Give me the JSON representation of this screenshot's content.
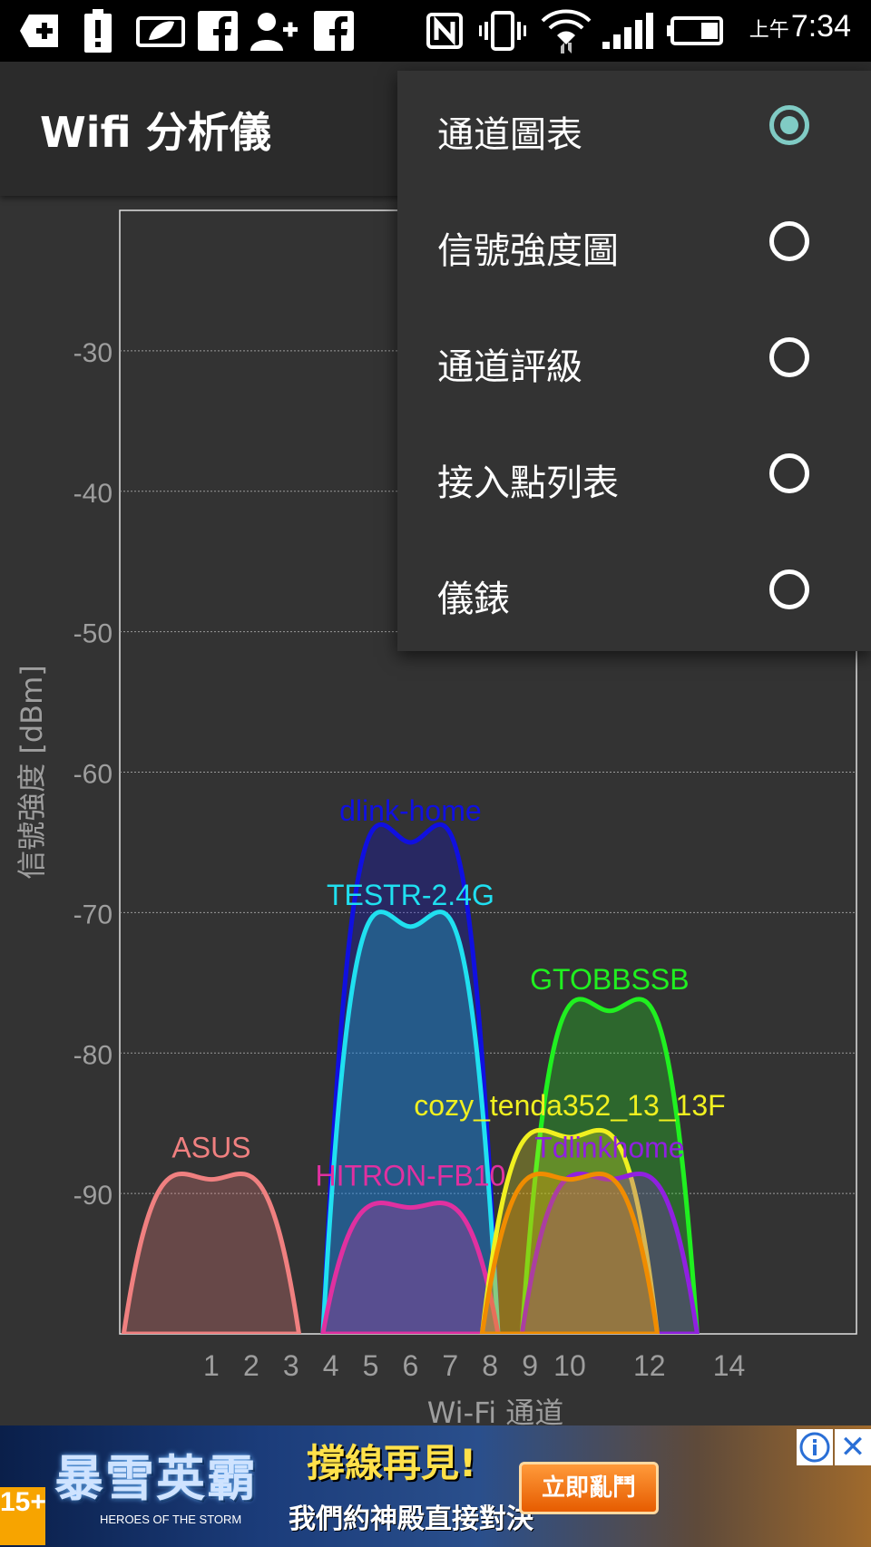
{
  "status_bar": {
    "time_prefix": "上午",
    "time": "7:34",
    "icons": [
      "add-box-icon",
      "battery-alert-icon",
      "leaf-icon",
      "facebook-icon",
      "add-user-icon",
      "facebook-icon",
      "nfc-icon",
      "vibrate-icon",
      "wifi-icon",
      "signal-icon",
      "battery-icon"
    ]
  },
  "app_bar": {
    "title": "Wifi 分析儀"
  },
  "menu": {
    "items": [
      {
        "label": "通道圖表",
        "checked": true
      },
      {
        "label": "信號強度圖",
        "checked": false
      },
      {
        "label": "通道評級",
        "checked": false
      },
      {
        "label": "接入點列表",
        "checked": false
      },
      {
        "label": "儀錶",
        "checked": false
      }
    ]
  },
  "chart_data": {
    "type": "area",
    "xlabel": "Wi-Fi 通道",
    "ylabel": "信號強度 [dBm]",
    "xlim": [
      -1.3,
      17.2
    ],
    "ylim": [
      -100,
      -20
    ],
    "x_ticks": [
      1,
      2,
      3,
      4,
      5,
      6,
      7,
      8,
      9,
      10,
      12,
      14
    ],
    "y_ticks": [
      -30,
      -40,
      -50,
      -60,
      -70,
      -80,
      -90
    ],
    "grid": true,
    "series": [
      {
        "name": "ASUS",
        "channel": 1,
        "level": -89,
        "color": "#f08080"
      },
      {
        "name": "dlink-home",
        "channel": 6,
        "level": -65,
        "color": "#1010e0"
      },
      {
        "name": "TESTR-2.4G",
        "channel": 6,
        "level": -71,
        "color": "#20e0f0"
      },
      {
        "name": "HITRON-FB10",
        "channel": 6,
        "level": -91,
        "color": "#e030a0"
      },
      {
        "name": "GTOBBSSB",
        "channel": 11,
        "level": -77,
        "color": "#20f020"
      },
      {
        "name": "cozy_tenda352_13_13F",
        "channel": 10,
        "level": -86,
        "color": "#f0f020"
      },
      {
        "name": "Tdlinkhome",
        "channel": 11,
        "level": -89,
        "color": "#9020e0"
      },
      {
        "name": "",
        "channel": 10,
        "level": -89,
        "color": "#f08c00"
      }
    ]
  },
  "ad": {
    "rating": "15+",
    "game_title": "暴雪英霸",
    "game_subtitle": "HEROES OF THE STORM",
    "headline": "撐線再見!",
    "subline": "我們約神殿直接對決",
    "cta": "立即亂鬥",
    "close_label": "✕"
  }
}
